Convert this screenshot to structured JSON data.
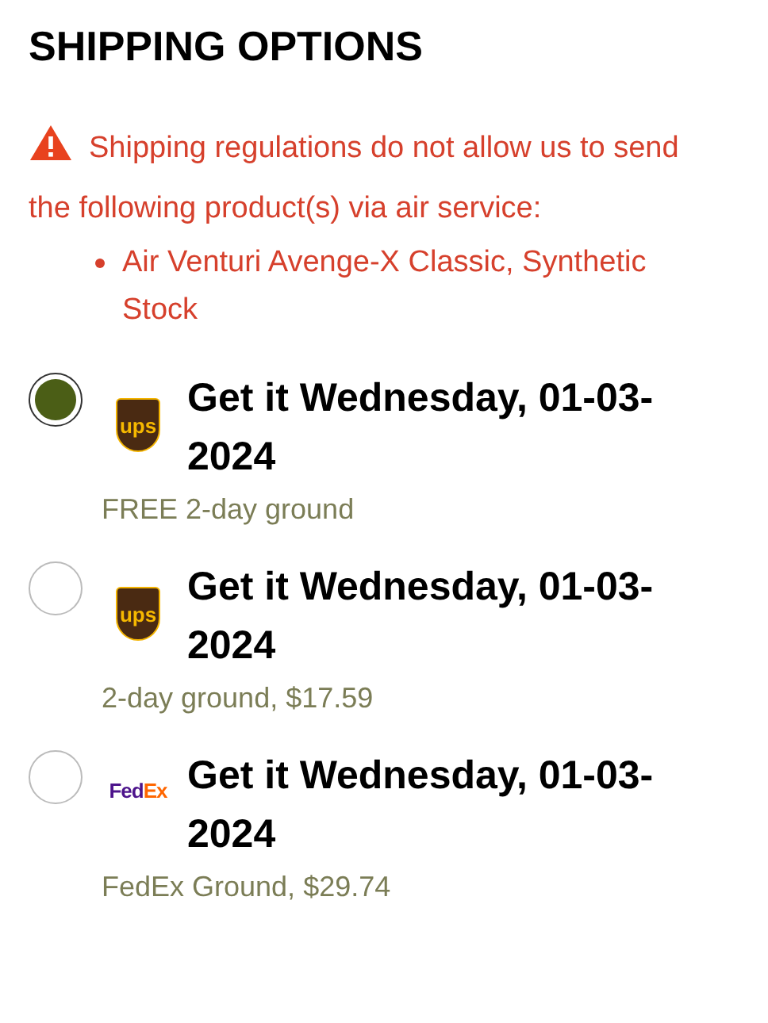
{
  "title": "SHIPPING OPTIONS",
  "warning": {
    "message": "Shipping regulations do not allow us to send the following product(s) via air service:",
    "products": [
      "Air Venturi Avenge-X Classic, Synthetic Stock"
    ]
  },
  "options": [
    {
      "selected": true,
      "kind": "ups",
      "logo_text": [
        "ups"
      ],
      "heading": "Get it Wednesday, 01-03-2024",
      "detail": "FREE 2-day ground"
    },
    {
      "selected": false,
      "kind": "ups",
      "logo_text": [
        "ups"
      ],
      "heading": "Get it Wednesday, 01-03-2024",
      "detail": "2-day ground, $17.59"
    },
    {
      "selected": false,
      "kind": "fedex",
      "logo_text": [
        "Fed",
        "Ex"
      ],
      "heading": "Get it Wednesday, 01-03-2024",
      "detail": "FedEx Ground, $29.74"
    }
  ]
}
